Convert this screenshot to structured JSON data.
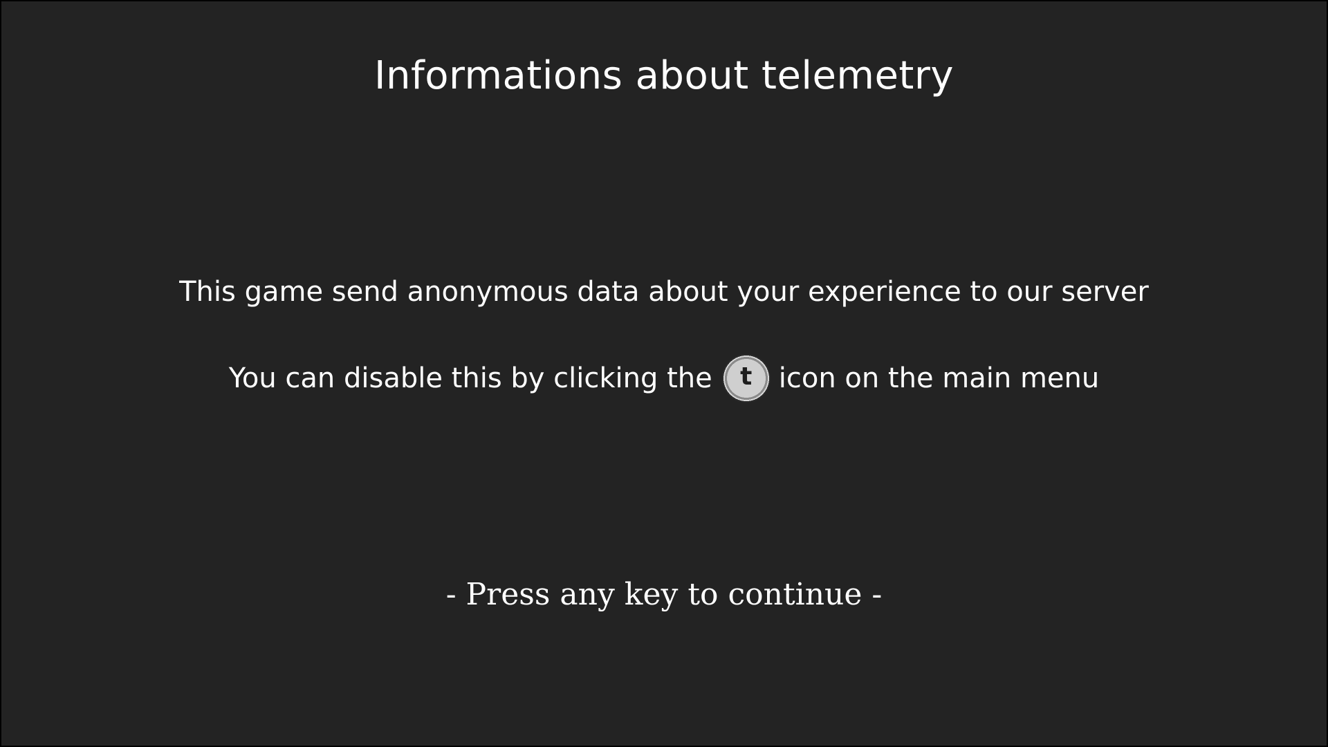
{
  "screen": {
    "title": "Informations about telemetry",
    "message_line1": "This game send anonymous data about your experience to our server",
    "message_line2_before": "You can disable this by clicking the",
    "telemetry_icon_letter": "t",
    "message_line2_after": "icon on the main menu",
    "continue_prompt": "- Press any key to continue -"
  },
  "colors": {
    "background": "#232323",
    "border": "#000000",
    "text": "#ffffff",
    "icon_fill": "#cfcfcf"
  }
}
